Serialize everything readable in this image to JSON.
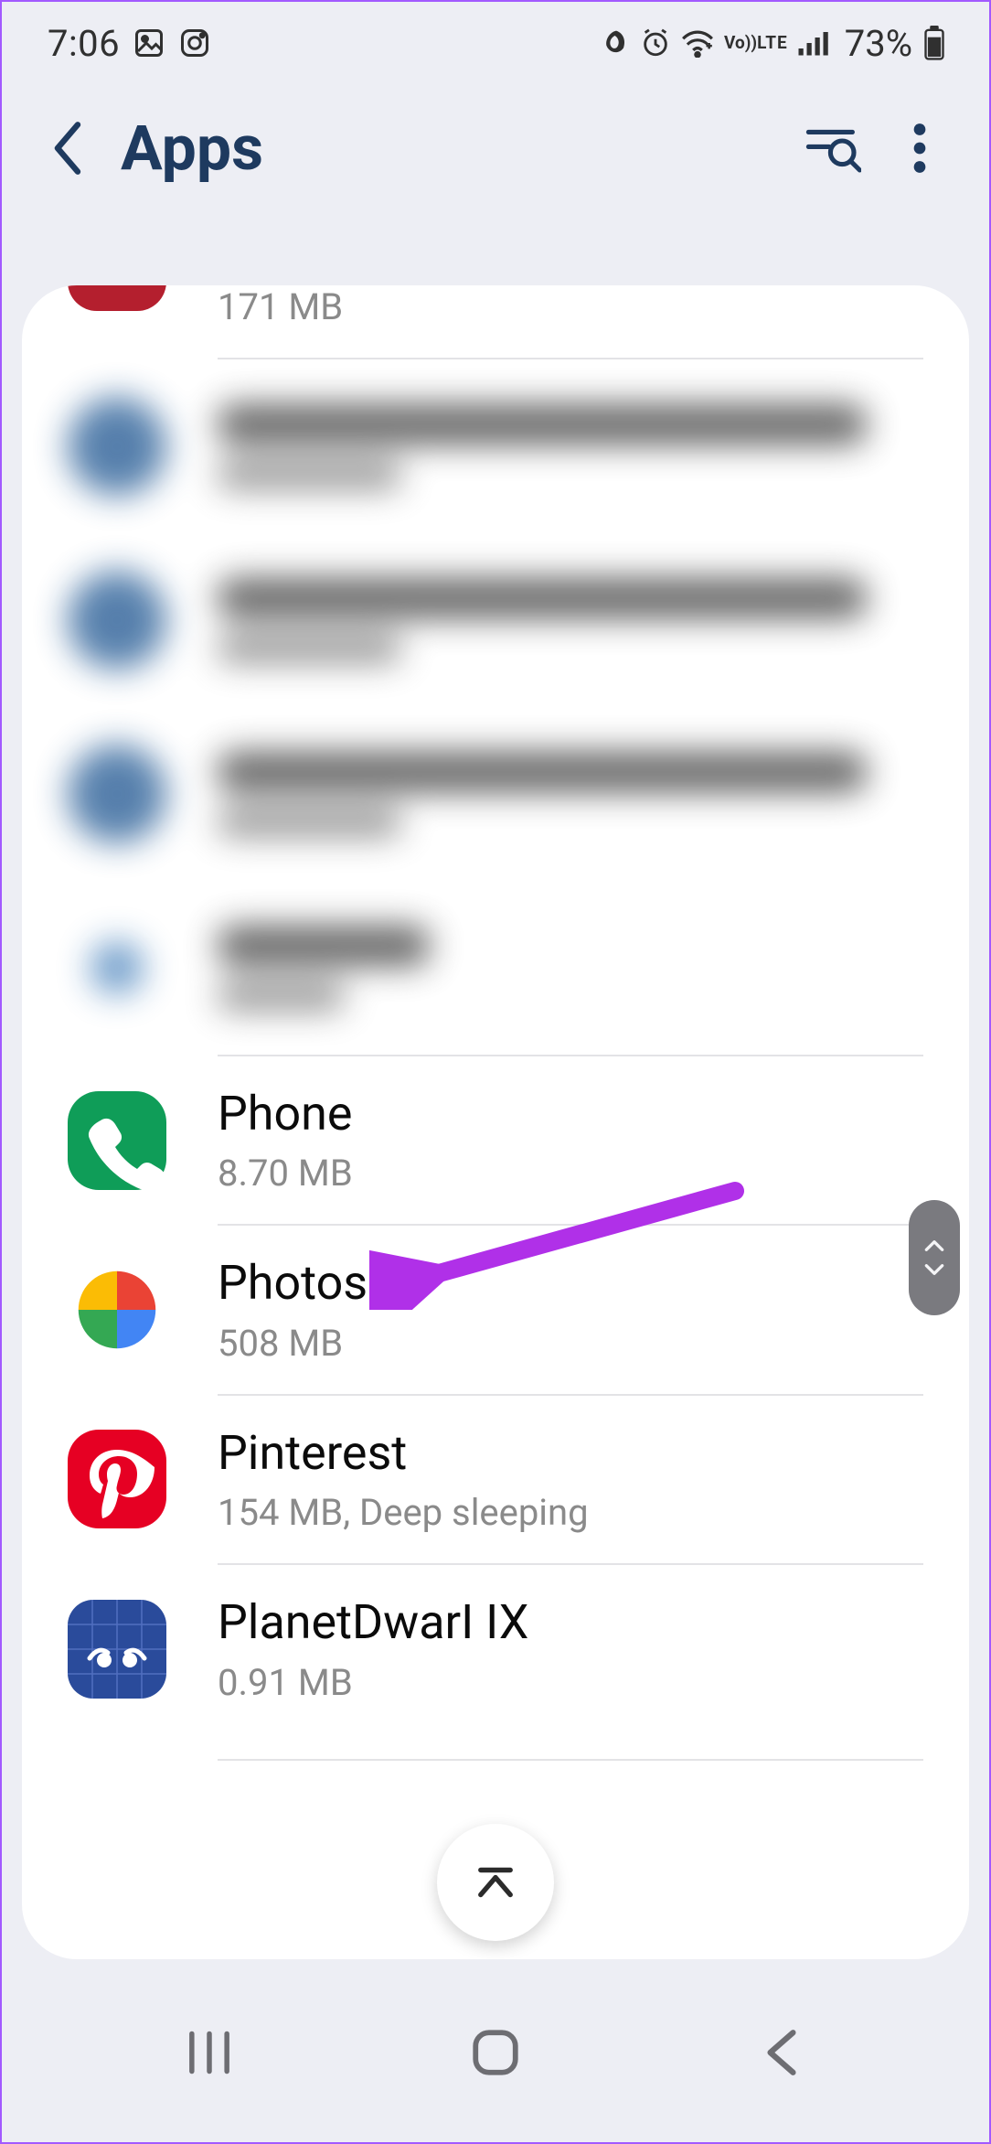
{
  "status": {
    "time": "7:06",
    "battery_pct": "73%",
    "icons": {
      "gallery": "gallery-icon",
      "instagram": "instagram-icon",
      "leaf": "leaf-icon",
      "alarm": "alarm-icon",
      "wifi": "wifi-icon",
      "volte": "VoLTE",
      "signal": "signal-icon",
      "battery": "battery-icon"
    }
  },
  "appbar": {
    "title": "Apps",
    "back": "back",
    "search": "search",
    "more": "more"
  },
  "list": {
    "truncated_top_size": "171 MB",
    "apps": [
      {
        "name": "Phone",
        "sub": "8.70 MB",
        "icon": "phone-app-icon"
      },
      {
        "name": "Photos",
        "sub": "508 MB",
        "icon": "photos-app-icon"
      },
      {
        "name": "Pinterest",
        "sub": "154 MB, Deep sleeping",
        "icon": "pinterest-app-icon"
      },
      {
        "name": "PlanetDwarI IX",
        "sub": "0.91 MB",
        "icon": "planet-app-icon"
      }
    ]
  },
  "scroll_index": {
    "up": "up",
    "down": "down"
  },
  "jump_top": "jump-to-top",
  "nav": {
    "recents": "recents",
    "home": "home",
    "back": "back"
  }
}
